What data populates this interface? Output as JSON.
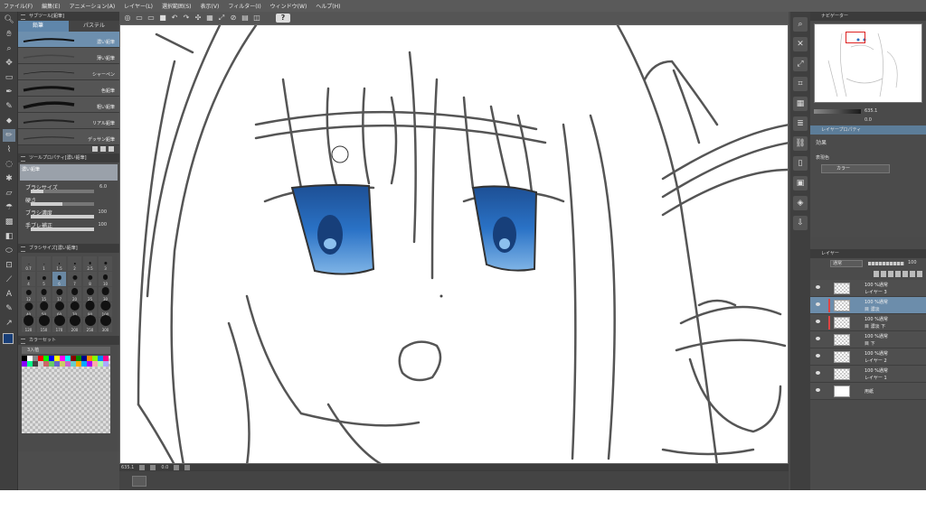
{
  "menu": [
    "ファイル(F)",
    "編集(E)",
    "アニメーション(A)",
    "レイヤー(L)",
    "選択範囲(S)",
    "表示(V)",
    "フィルター(I)",
    "ウィンドウ(W)",
    "ヘルプ(H)"
  ],
  "colors": {
    "accent": "#5f86aa",
    "selected_row": "#6c8dab",
    "eye_blue": "#2a6fc4",
    "main_color": "#183e77"
  },
  "subtool": {
    "title": "サブツール[鉛筆]",
    "tabs": [
      "鉛筆",
      "パステル"
    ],
    "brushes": [
      "濃い鉛筆",
      "薄い鉛筆",
      "シャーペン",
      "色鉛筆",
      "粗い鉛筆",
      "リアル鉛筆",
      "デッサン鉛筆"
    ]
  },
  "tool_property": {
    "title": "ツールプロパティ[濃い鉛筆]",
    "tool_name": "濃い鉛筆",
    "rows": [
      {
        "label": "ブラシサイズ",
        "value": "6.0",
        "level": 0.2
      },
      {
        "label": "硬さ",
        "value": "",
        "level": 0.5
      },
      {
        "label": "ブラシ濃度",
        "value": "100",
        "level": 1.0
      },
      {
        "label": "手ブレ補正",
        "value": "100",
        "level": 1.0
      }
    ]
  },
  "brush_size": {
    "title": "ブラシサイズ[濃い鉛筆]",
    "sizes": [
      "0.7",
      "1",
      "1.5",
      "2",
      "2.5",
      "3",
      "4",
      "5",
      "6",
      "7",
      "8",
      "10",
      "12",
      "15",
      "17",
      "20",
      "25",
      "30",
      "40",
      "50",
      "60",
      "70",
      "80",
      "100",
      "120",
      "150",
      "170",
      "200",
      "250",
      "300"
    ],
    "selected": "6"
  },
  "color_set": {
    "title": "カラーセット",
    "name": "3入植"
  },
  "navigator": {
    "title": "ナビゲーター",
    "zoom": "635.1",
    "angle": "0.0"
  },
  "layer_property": {
    "title": "レイヤープロパティ",
    "effect_label": "効果",
    "color_label": "表現色",
    "color_value": "カラー"
  },
  "layers_panel": {
    "title": "レイヤー",
    "blend_mode": "通常",
    "opacity": "100",
    "layers": [
      {
        "percent": "100 %通常",
        "name": "レイヤー 3",
        "selected": false,
        "red": false,
        "paper": false
      },
      {
        "percent": "100 %通常",
        "name": "目 濃淡",
        "selected": true,
        "red": true,
        "paper": false
      },
      {
        "percent": "100 %通常",
        "name": "目 濃淡 下",
        "selected": false,
        "red": true,
        "paper": false
      },
      {
        "percent": "100 %通常",
        "name": "目 下",
        "selected": false,
        "red": false,
        "paper": false
      },
      {
        "percent": "100 %通常",
        "name": "レイヤー 2",
        "selected": false,
        "red": false,
        "paper": false
      },
      {
        "percent": "100 %通常",
        "name": "レイヤー 1",
        "selected": false,
        "red": false,
        "paper": false
      },
      {
        "percent": "",
        "name": "用紙",
        "selected": false,
        "red": false,
        "paper": true
      }
    ]
  },
  "status": {
    "zoom": "635.1",
    "angle": "0.0"
  }
}
